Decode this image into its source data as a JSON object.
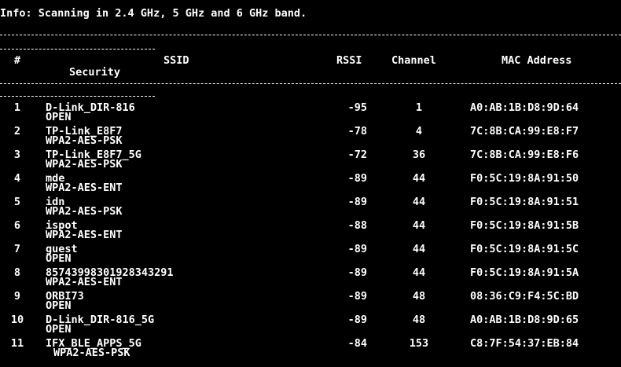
{
  "info_line": "Info: Scanning in 2.4 GHz, 5 GHz and 6 GHz band.",
  "header": {
    "num": "#",
    "ssid": "SSID",
    "security": "Security",
    "rssi": "RSSI",
    "channel": "Channel",
    "mac": "MAC Address"
  },
  "rows": [
    {
      "num": "1",
      "ssid": "D-Link_DIR-816",
      "security": "OPEN",
      "rssi": "-95",
      "channel": "1",
      "mac": "A0:AB:1B:D8:9D:64"
    },
    {
      "num": "2",
      "ssid": "TP-Link_E8F7",
      "security": "WPA2-AES-PSK",
      "rssi": "-78",
      "channel": "4",
      "mac": "7C:8B:CA:99:E8:F7"
    },
    {
      "num": "3",
      "ssid": "TP-Link_E8F7_5G",
      "security": "WPA2-AES-PSK",
      "rssi": "-72",
      "channel": "36",
      "mac": "7C:8B:CA:99:E8:F6"
    },
    {
      "num": "4",
      "ssid": "mde",
      "security": "WPA2-AES-ENT",
      "rssi": "-89",
      "channel": "44",
      "mac": "F0:5C:19:8A:91:50"
    },
    {
      "num": "5",
      "ssid": "idn",
      "security": "WPA2-AES-PSK",
      "rssi": "-89",
      "channel": "44",
      "mac": "F0:5C:19:8A:91:51"
    },
    {
      "num": "6",
      "ssid": "ispot",
      "security": "WPA2-AES-ENT",
      "rssi": "-88",
      "channel": "44",
      "mac": "F0:5C:19:8A:91:5B"
    },
    {
      "num": "7",
      "ssid": "guest",
      "security": "OPEN",
      "rssi": "-89",
      "channel": "44",
      "mac": "F0:5C:19:8A:91:5C"
    },
    {
      "num": "8",
      "ssid": "85743998301928343291",
      "security": "WPA2-AES-ENT",
      "rssi": "-89",
      "channel": "44",
      "mac": "F0:5C:19:8A:91:5A"
    },
    {
      "num": "9",
      "ssid": "ORBI73",
      "security": "OPEN",
      "rssi": "-89",
      "channel": "48",
      "mac": "08:36:C9:F4:5C:BD"
    },
    {
      "num": "10",
      "ssid": "D-Link_DIR-816_5G",
      "security": "OPEN",
      "rssi": "-89",
      "channel": "48",
      "mac": "A0:AB:1B:D8:9D:65"
    },
    {
      "num": "11",
      "ssid": "IFX_BLE_APPS_5G",
      "security": "WPA2-AES-PSK",
      "rssi": "-84",
      "channel": "153",
      "mac": "C8:7F:54:37:EB:84"
    }
  ]
}
